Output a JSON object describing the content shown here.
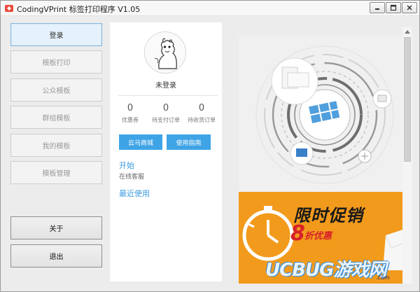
{
  "window": {
    "title": "CodingVPrint 标签打印程序 V1.05"
  },
  "sidebar": {
    "items": [
      {
        "label": "登录",
        "state": "active"
      },
      {
        "label": "模板打印",
        "state": "disabled"
      },
      {
        "label": "公众模板",
        "state": "disabled"
      },
      {
        "label": "群组模板",
        "state": "disabled"
      },
      {
        "label": "我的模板",
        "state": "disabled"
      },
      {
        "label": "模板管理",
        "state": "disabled"
      }
    ],
    "about_label": "关于",
    "exit_label": "退出"
  },
  "profile": {
    "status": "未登录",
    "stats": [
      {
        "value": "0",
        "label": "优惠券"
      },
      {
        "value": "0",
        "label": "待支付订单"
      },
      {
        "value": "0",
        "label": "待收货订单"
      }
    ],
    "buttons": {
      "shop": "云马商城",
      "guide": "使用指南"
    },
    "start_title": "开始",
    "online_support": "在线客服",
    "recent_title": "最近使用"
  },
  "banner": {
    "promo_title": "限时促销",
    "promo_number": "8",
    "promo_subtitle": "折优惠",
    "watermark": "UCBUG游戏网",
    "watermark_url": ".com"
  },
  "colors": {
    "accent": "#3fa4e6",
    "promo_bg": "#f29a1c",
    "promo_red": "#d8212a"
  }
}
